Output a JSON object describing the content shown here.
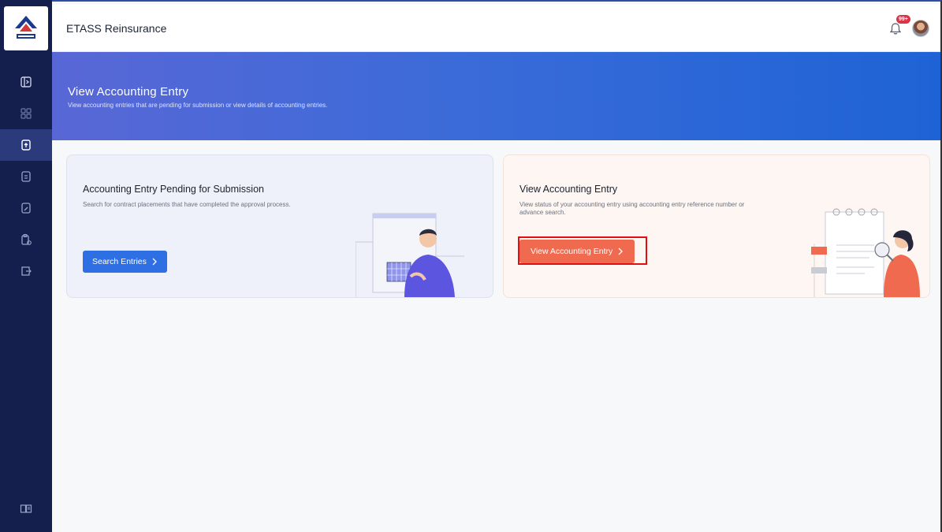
{
  "app": {
    "title": "ETASS Reinsurance",
    "notification_badge": "99+"
  },
  "sidebar": {
    "logo": "company-logo",
    "items": [
      {
        "icon": "panel-toggle-icon",
        "active": false
      },
      {
        "icon": "dashboard-grid-icon",
        "active": false
      },
      {
        "icon": "document-upload-icon",
        "active": true
      },
      {
        "icon": "document-list-icon",
        "active": false
      },
      {
        "icon": "document-edit-icon",
        "active": false
      },
      {
        "icon": "clipboard-settings-icon",
        "active": false
      },
      {
        "icon": "export-icon",
        "active": false
      }
    ],
    "bottom_icon": "book-icon"
  },
  "banner": {
    "title": "View Accounting Entry",
    "subtitle": "View accounting entries that are pending for submission or view details of accounting entries."
  },
  "cards": {
    "pending": {
      "title": "Accounting Entry Pending for Submission",
      "description": "Search for contract placements that have completed the approval process.",
      "button_label": "Search Entries"
    },
    "view": {
      "title": "View Accounting Entry",
      "description": "View status of your accounting entry using accounting entry reference number or advance search.",
      "button_label": "View Accounting Entry"
    }
  },
  "colors": {
    "sidebar": "#141f4d",
    "banner_start": "#5967d6",
    "banner_end": "#1e63d6",
    "primary_button": "#2f6fe4",
    "accent_button": "#ef6a4f",
    "highlight": "#e01010"
  }
}
